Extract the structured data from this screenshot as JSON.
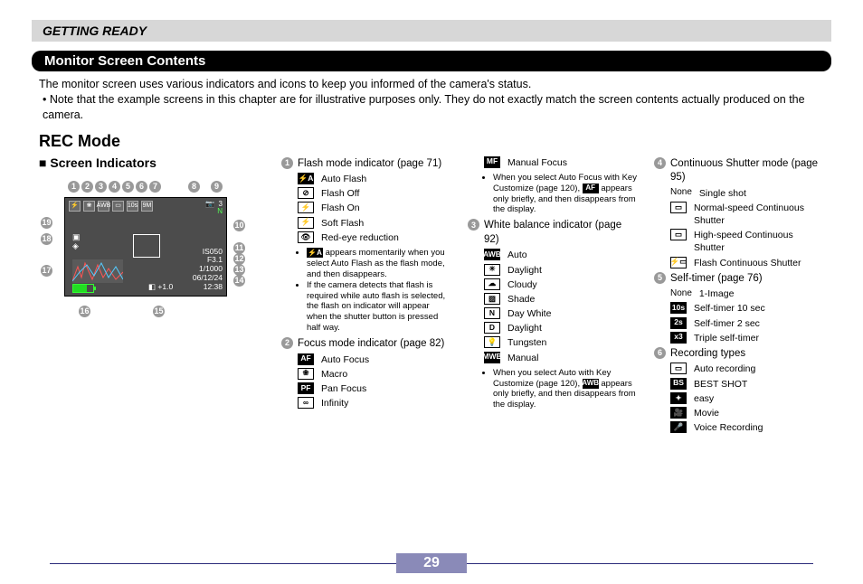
{
  "chapter": "GETTING READY",
  "section": "Monitor Screen Contents",
  "intro": {
    "line1": "The monitor screen uses various indicators and icons to keep you informed of the camera's status.",
    "line2": "Note that the example screens in this chapter are for illustrative purposes only. They do not exactly match the screen contents actually produced on the camera."
  },
  "rec_mode_heading": "REC Mode",
  "screen_indicators_heading": "Screen Indicators",
  "lcd": {
    "n_value": "N",
    "shots": "3",
    "iso": "IS050",
    "f": "F3.1",
    "shutter": "1/1000",
    "date": "06/12/24",
    "time": "12:38",
    "ev": "+1.0",
    "timer_icon": "10s",
    "camera_icon": "📷"
  },
  "flash": {
    "title": "Flash mode indicator (page 71)",
    "items": [
      {
        "ico_text": "⚡A",
        "style": "filled",
        "label": "Auto Flash"
      },
      {
        "ico_text": "⊘",
        "style": "empty",
        "label": "Flash Off"
      },
      {
        "ico_text": "⚡",
        "style": "empty",
        "label": "Flash On"
      },
      {
        "ico_text": "⚡",
        "style": "empty",
        "label": "Soft Flash"
      },
      {
        "ico_text": "👁",
        "style": "empty",
        "label": "Red-eye reduction"
      }
    ],
    "note1_pre": "",
    "note1_ico": "⚡A",
    "note1_post": " appears momentarily when you select Auto Flash as the flash mode, and then disappears.",
    "note2": "If the camera detects that flash is required while auto flash is selected, the flash on indicator will appear when the shutter button is pressed half way."
  },
  "focus": {
    "title": "Focus mode indicator (page 82)",
    "items": [
      {
        "ico_text": "AF",
        "style": "filled",
        "label": "Auto Focus"
      },
      {
        "ico_text": "❀",
        "style": "empty",
        "label": "Macro"
      },
      {
        "ico_text": "PF",
        "style": "filled",
        "label": "Pan Focus"
      },
      {
        "ico_text": "∞",
        "style": "empty",
        "label": "Infinity"
      },
      {
        "ico_text": "MF",
        "style": "filled",
        "label": "Manual Focus"
      }
    ],
    "note_pre": "When you select Auto Focus with Key Customize (page 120), ",
    "note_ico": "AF",
    "note_post": " appears only briefly, and then disappears from the display."
  },
  "wb": {
    "title": "White balance indicator (page 92)",
    "items": [
      {
        "ico_text": "AWB",
        "style": "filled",
        "label": "Auto"
      },
      {
        "ico_text": "☀",
        "style": "empty",
        "label": "Daylight"
      },
      {
        "ico_text": "☁",
        "style": "empty",
        "label": "Cloudy"
      },
      {
        "ico_text": "▨",
        "style": "empty",
        "label": "Shade"
      },
      {
        "ico_text": "N",
        "style": "empty",
        "label": "Day White"
      },
      {
        "ico_text": "D",
        "style": "empty",
        "label": "Daylight"
      },
      {
        "ico_text": "💡",
        "style": "empty",
        "label": "Tungsten"
      },
      {
        "ico_text": "MWB",
        "style": "filled",
        "label": "Manual"
      }
    ],
    "note_pre": "When you select Auto with Key Customize (page 120), ",
    "note_ico": "AWB",
    "note_post": " appears only briefly, and then disappears from the display."
  },
  "cs": {
    "title": "Continuous Shutter mode (page 95)",
    "items": [
      {
        "ico_text": "None",
        "style": "none",
        "label": "Single shot"
      },
      {
        "ico_text": "▭",
        "style": "empty",
        "label": "Normal-speed Continuous Shutter"
      },
      {
        "ico_text": "▭",
        "style": "empty",
        "label": "High-speed Continuous Shutter"
      },
      {
        "ico_text": "⚡▭",
        "style": "empty",
        "label": "Flash Continuous Shutter"
      }
    ]
  },
  "st": {
    "title": "Self-timer (page 76)",
    "items": [
      {
        "ico_text": "None",
        "style": "none",
        "label": "1-Image"
      },
      {
        "ico_text": "10s",
        "style": "filled",
        "label": "Self-timer 10 sec"
      },
      {
        "ico_text": "2s",
        "style": "filled",
        "label": "Self-timer 2 sec"
      },
      {
        "ico_text": "x3",
        "style": "filled",
        "label": "Triple self-timer"
      }
    ]
  },
  "rt": {
    "title": "Recording types",
    "items": [
      {
        "ico_text": "▭",
        "style": "empty",
        "label": "Auto recording"
      },
      {
        "ico_text": "BS",
        "style": "filled",
        "label": "BEST SHOT"
      },
      {
        "ico_text": "✦",
        "style": "filled",
        "label": "easy"
      },
      {
        "ico_text": "🎥",
        "style": "filled",
        "label": "Movie"
      },
      {
        "ico_text": "🎤",
        "style": "filled",
        "label": "Voice Recording"
      }
    ]
  },
  "page_number": "29",
  "nums": {
    "n1": "1",
    "n2": "2",
    "n3": "3",
    "n4": "4",
    "n5": "5",
    "n6": "6"
  }
}
